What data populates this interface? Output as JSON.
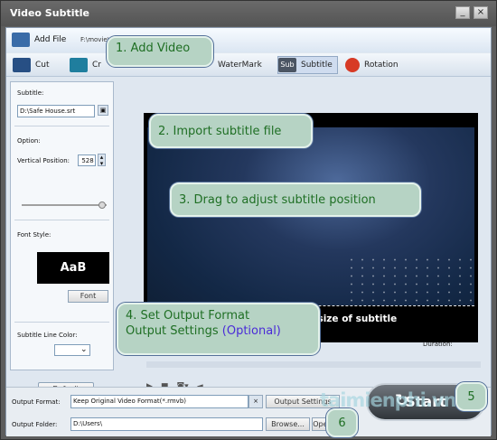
{
  "window": {
    "title": "Video Subtitle"
  },
  "toolbar": {
    "add_file_label": "Add File",
    "file_path": "F:\\movie\\",
    "tabs": [
      {
        "label": "Cut",
        "icon": "cut-film-icon"
      },
      {
        "label": "Cr"
      },
      {
        "label": "WaterMark",
        "icon": "watermark-icon"
      },
      {
        "label": "Subtitle",
        "icon": "subtitle-icon",
        "selected": true
      },
      {
        "label": "Rotation",
        "icon": "rotation-icon"
      }
    ]
  },
  "left_panel": {
    "subtitle_label": "Subtitle:",
    "subtitle_value": "D:\\Safe House.srt",
    "option_label": "Option:",
    "vertical_position_label": "Vertical Position:",
    "vertical_position_value": "528",
    "font_style_label": "Font Style:",
    "font_sample": "AaB",
    "font_button": "Font",
    "line_color_label": "Subtitle Line Color:",
    "default_button": "Default"
  },
  "preview": {
    "subtitle_text": "The position and size of subtitle",
    "duration_label": "Duration:"
  },
  "bottom": {
    "output_format_label": "Output Format:",
    "output_format_value": "Keep Original Video Format(*.rmvb)",
    "output_settings_button": "Output Settings",
    "output_folder_label": "Output Folder:",
    "output_folder_value": "D:\\Users\\",
    "browse_button": "Browse...",
    "open_button": "Oper",
    "start_button": "Start"
  },
  "callouts": {
    "c1": "1. Add Video",
    "c2": "2. Import subtitle file",
    "c3": "3. Drag to adjust subtitle position",
    "c4_line1": "4. Set Output Format",
    "c4_line2": "Output Settings",
    "c4_line3": "(Optional)",
    "c5": "5",
    "c6": "6"
  },
  "watermark": "taimienphi.vn",
  "colors": {
    "accent": "#1f58a6",
    "callout_green": "#b6d3c4"
  }
}
